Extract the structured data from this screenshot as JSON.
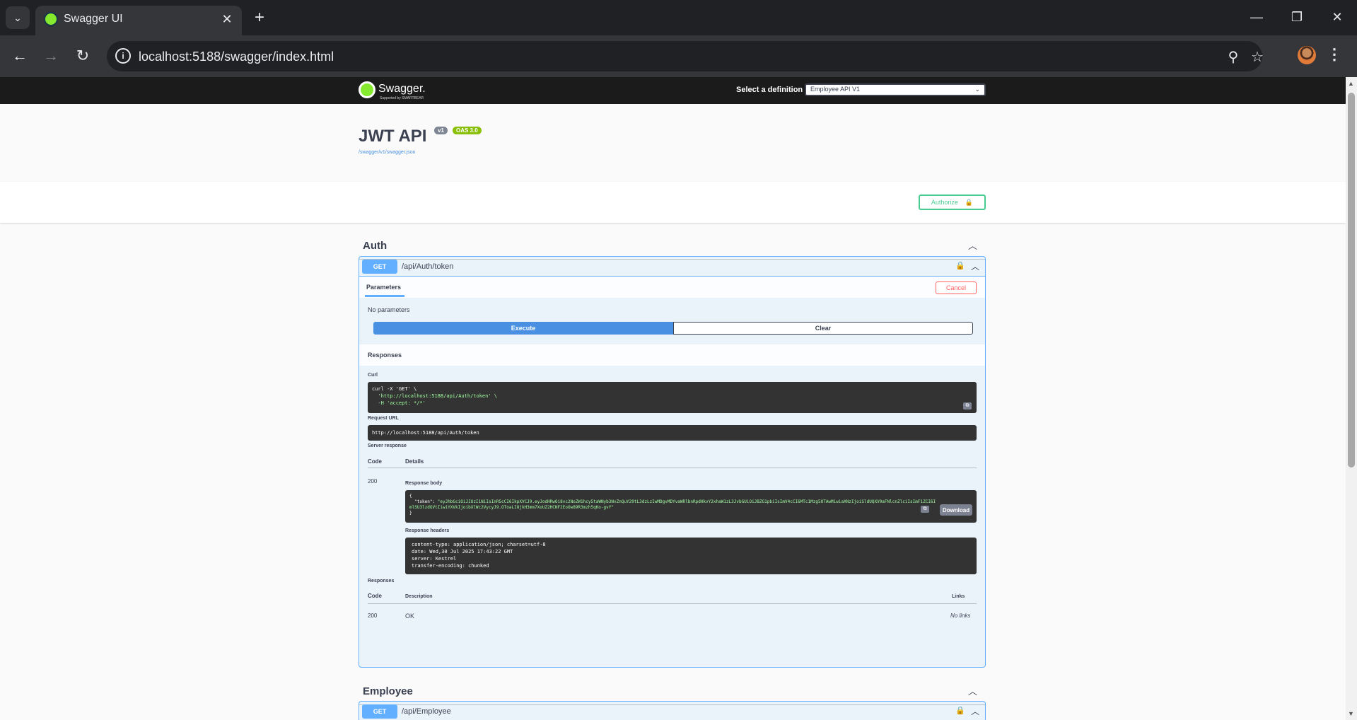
{
  "browser": {
    "tab_title": "Swagger UI",
    "tab_close": "✕",
    "new_tab": "+",
    "url": "localhost:5188/swagger/index.html"
  },
  "swagger": {
    "logo_text": "Swagger.",
    "logo_subtext": "Supported by SMARTBEAR",
    "definition_label": "Select a definition",
    "definition_value": "Employee API V1",
    "title": "JWT API",
    "version_badge": "v1",
    "oas_badge": "OAS 3.0",
    "spec_link": "/swagger/v1/swagger.json",
    "authorize_label": "Authorize"
  },
  "auth_section": {
    "tag_name": "Auth",
    "method": "GET",
    "path": "/api/Auth/token",
    "parameters_tab": "Parameters",
    "cancel_label": "Cancel",
    "no_parameters": "No parameters",
    "execute_label": "Execute",
    "clear_label": "Clear",
    "responses_heading": "Responses",
    "curl_label": "Curl",
    "curl_line1": "curl -X 'GET' \\",
    "curl_line2": "  'http://localhost:5188/api/Auth/token' \\",
    "curl_line3": "  -H 'accept: */*'",
    "request_url_label": "Request URL",
    "request_url": "http://localhost:5188/api/Auth/token",
    "server_response_label": "Server response",
    "code_header": "Code",
    "details_header": "Details",
    "response_code": "200",
    "response_body_label": "Response body",
    "body_open": "{",
    "body_key": "  \"token\": ",
    "body_token_part1": "\"eyJhbGciOiJIUzI1NiIsInR5cCI6IkpXVCJ9.eyJodHRwOi8vc2NoZW1hcy5taWNyb3NvZnQuY29tL3dzLzIwMDgvMDYvaWRlbnRpdHkvY2xhaW1zL3JvbGUiOiJBZG1pbiIsImV4cCI6MTc1Mzg5OTAwMiwiaXNzIjoiSldUQXV0aFNlcnZlciIsImF1ZCI6I",
    "body_token_part2": "mlSU3lzdGVtIiwiYXVkIjoibXlWc2VycyJ9.OToaLI8jkH3mm7XoUZ2HCNF2EoOw89R3mzh5qKo-gvY\"",
    "body_close": "}",
    "download_label": "Download",
    "response_headers_label": "Response headers",
    "headers": [
      "content-type: application/json; charset=utf-8",
      "date: Wed,30 Jul 2025 17:43:22 GMT",
      "server: Kestrel",
      "transfer-encoding: chunked"
    ],
    "responses_label": "Responses",
    "description_header": "Description",
    "links_header": "Links",
    "resp_code": "200",
    "resp_description": "OK",
    "resp_links": "No links"
  },
  "employee_section": {
    "tag_name": "Employee",
    "method": "GET",
    "path": "/api/Employee"
  },
  "colors": {
    "get": "#61affe",
    "authorize": "#49cc90",
    "cancel": "#ff6060",
    "execute": "#4990e2",
    "oas_badge": "#89bf04"
  }
}
